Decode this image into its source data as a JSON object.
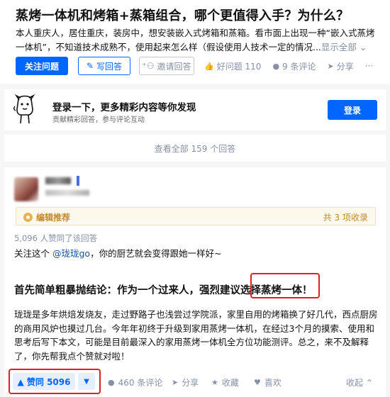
{
  "question": {
    "title": "蒸烤一体机和烤箱+蒸箱组合，哪个更值得入手？为什么？",
    "description": "本人重庆人，居住重庆，装房中，想安装嵌入式烤箱和蒸箱。看市面上出现一种“嵌入式蒸烤一体机”，不知道技术成熟不，使用起来怎么样（假设使用人技术一定的情况...",
    "show_all": "显示全部 ⌄",
    "follow_label": "关注问题",
    "write_label": "写回答",
    "invite_label": "邀请回答",
    "good_question": "好问题 110",
    "comments": "9 条评论",
    "share": "分享",
    "more": "···"
  },
  "login_banner": {
    "title": "登录一下，更多精彩内容等你发现",
    "subtitle": "贡献精彩回答，参与评论互动",
    "button": "登录"
  },
  "view_all": "查看全部 159 个回答",
  "answer": {
    "editor_pick": "编辑推荐",
    "collections": "共 3 项收录",
    "agree_count": "5,096 人赞同了该回答",
    "attention_prefix": "关注这个 ",
    "mention": "@珑珑go",
    "attention_suffix": "，你的厨艺就会变得跟她一样好~",
    "heading": "首先简单粗暴抛结论：作为一个过来人，强烈建议选择蒸烤一体！",
    "paragraph": "珑珑是多年烘焙发烧友，走过野路子也浅尝过学院派，家里自用的烤箱换了好几代，西点厨房的商用风炉也摸过几台。今年年初终于升级到家用蒸烤一体机，在经过3个月的摸索、使用和思考后写下本文，可能是目前最深入的家用蒸烤一体机全方位功能测评。总之，来不及解释了，你先帮我点个赞就对啦！",
    "upvote": "▲ 赞同 5096",
    "downvote": "▼",
    "comments": "460 条评论",
    "share": "分享",
    "favorite": "收藏",
    "like": "喜欢",
    "collapse": "收起 ⌃"
  },
  "colors": {
    "accent": "#0066ff",
    "highlight": "#e02020",
    "muted": "#8590a6"
  }
}
